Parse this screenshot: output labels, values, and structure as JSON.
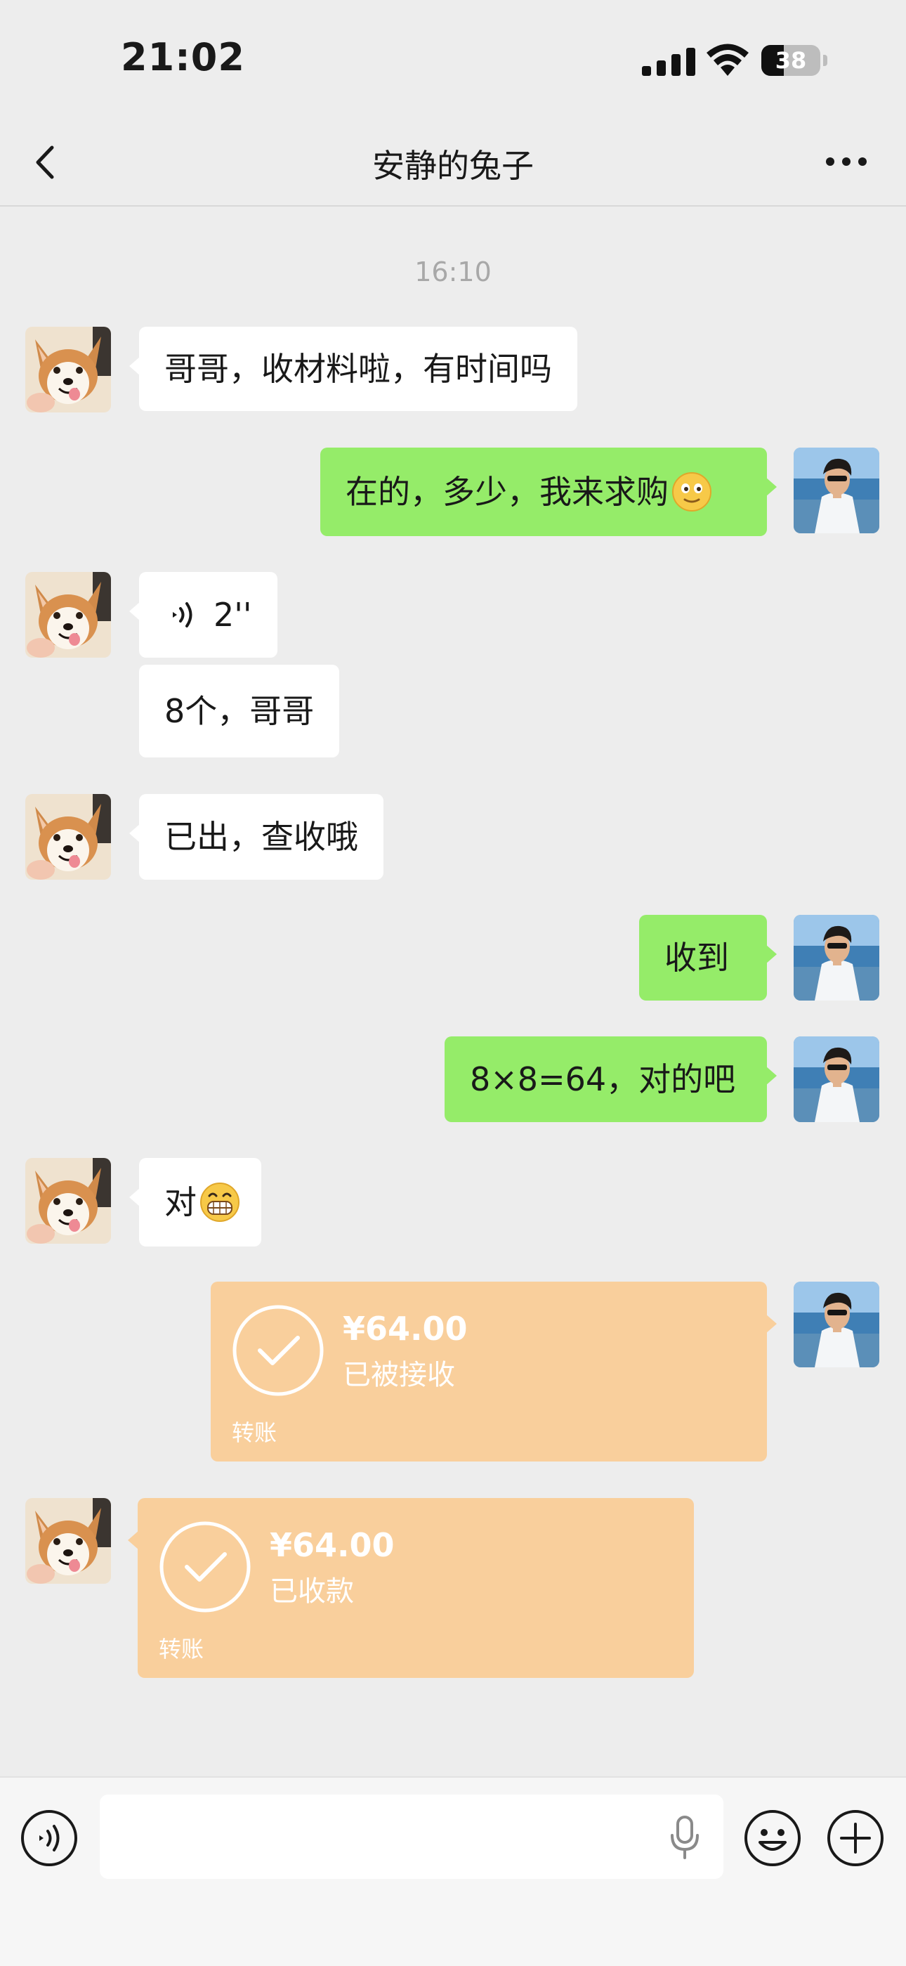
{
  "status_bar": {
    "time": "21:02",
    "battery_level": "38"
  },
  "header": {
    "title": "安静的兔子",
    "back_icon": "chevron-left-icon",
    "more_icon": "ellipsis-icon"
  },
  "chat": {
    "timestamp": "16:10",
    "messages": [
      {
        "from": "contact",
        "type": "text",
        "text": "哥哥，收材料啦，有时间吗"
      },
      {
        "from": "me",
        "type": "text",
        "text": "在的，多少，我来求购",
        "emoji": "smiling-face-emoji"
      },
      {
        "from": "contact",
        "type": "voice",
        "duration": "2''"
      },
      {
        "from": "contact",
        "type": "text",
        "text": "8个，哥哥"
      },
      {
        "from": "contact",
        "type": "text",
        "text": "已出，查收哦"
      },
      {
        "from": "me",
        "type": "text",
        "text": "收到"
      },
      {
        "from": "me",
        "type": "text",
        "text": "8×8=64，对的吧"
      },
      {
        "from": "contact",
        "type": "text",
        "text": "对",
        "emoji": "grinning-face-emoji"
      },
      {
        "from": "me",
        "type": "transfer",
        "amount": "¥64.00",
        "status": "已被接收",
        "kind": "转账"
      },
      {
        "from": "contact",
        "type": "transfer",
        "amount": "¥64.00",
        "status": "已收款",
        "kind": "转账"
      }
    ]
  },
  "input_bar": {
    "placeholder": "",
    "icons": [
      "voice-icon",
      "microphone-icon",
      "emoji-icon",
      "plus-icon"
    ]
  },
  "colors": {
    "background": "#ededed",
    "incoming_bubble": "#ffffff",
    "outgoing_bubble": "#95ec69",
    "transfer_card": "#f9cf9c"
  }
}
